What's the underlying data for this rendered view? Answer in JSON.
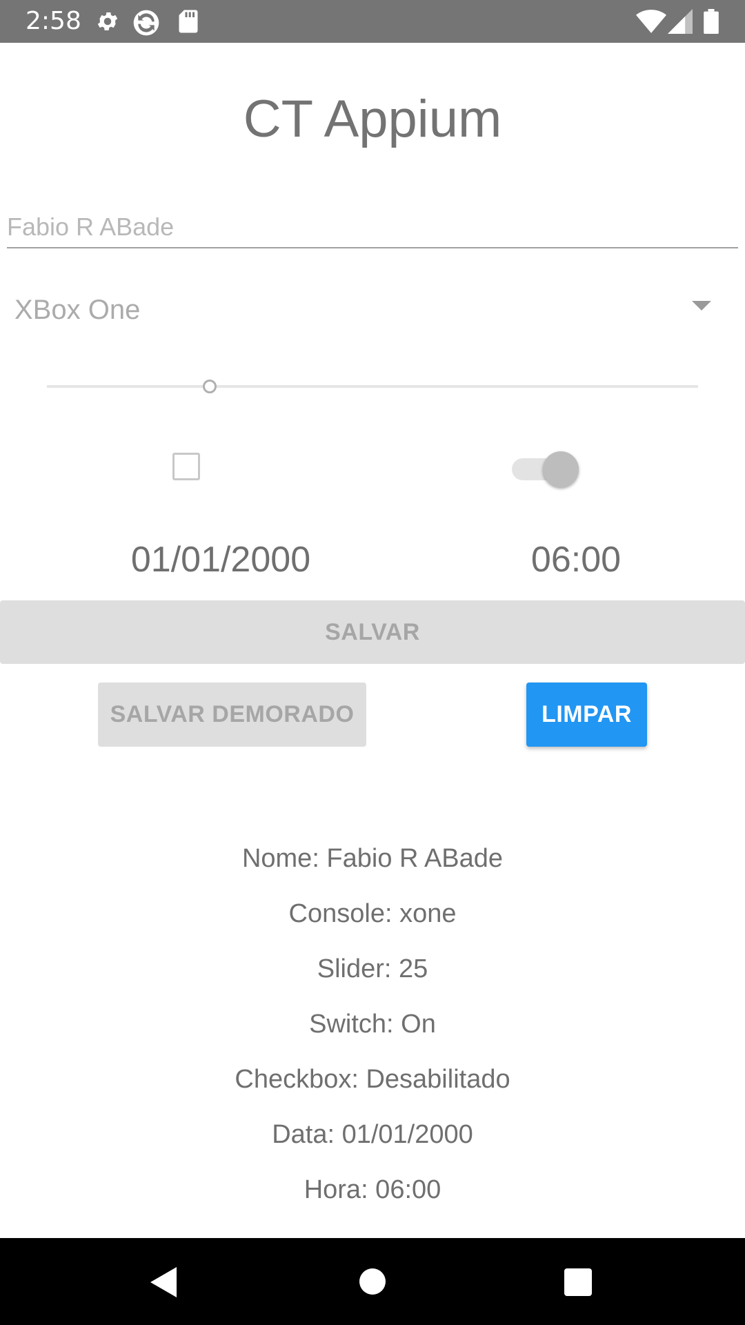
{
  "status_bar": {
    "time": "2:58",
    "left_icons": [
      "gear-icon",
      "sync-icon",
      "sd-card-icon"
    ],
    "right_icons": [
      "wifi-icon",
      "signal-icon",
      "battery-icon"
    ]
  },
  "app": {
    "title": "CT Appium"
  },
  "form": {
    "name_placeholder": "Fabio R ABade",
    "console_selected": "XBox One",
    "slider_value": 25,
    "checkbox_checked": false,
    "switch_on": true,
    "date": "01/01/2000",
    "time": "06:00"
  },
  "buttons": {
    "save": "SALVAR",
    "save_delayed": "SALVAR DEMORADO",
    "clear": "LIMPAR"
  },
  "results": {
    "name": "Nome: Fabio R ABade",
    "console": "Console: xone",
    "slider": "Slider: 25",
    "switch": "Switch: On",
    "checkbox": "Checkbox: Desabilitado",
    "date": "Data: 01/01/2000",
    "time": "Hora: 06:00"
  },
  "nav_bar": {
    "icons": [
      "back-icon",
      "home-icon",
      "recents-icon"
    ]
  },
  "colors": {
    "status_bar": "#757575",
    "accent": "#2196f3",
    "disabled_button": "#dedede",
    "nav_bar": "#000000"
  }
}
